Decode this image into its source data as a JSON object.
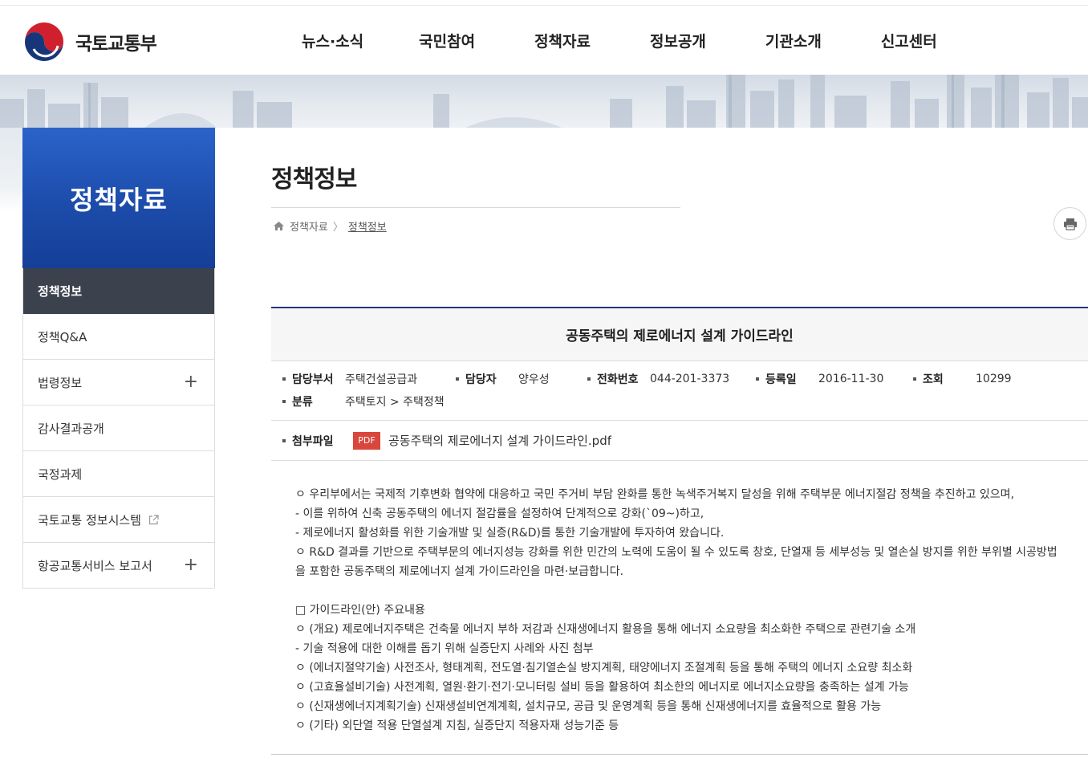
{
  "header": {
    "logo_text": "국토교통부",
    "nav": [
      "뉴스·소식",
      "국민참여",
      "정책자료",
      "정보공개",
      "기관소개",
      "신고센터"
    ]
  },
  "sidebar": {
    "title": "정책자료",
    "items": [
      {
        "label": "정책정보",
        "active": true,
        "expandable": false,
        "external": false
      },
      {
        "label": "정책Q&A",
        "active": false,
        "expandable": false,
        "external": false
      },
      {
        "label": "법령정보",
        "active": false,
        "expandable": true,
        "external": false
      },
      {
        "label": "감사결과공개",
        "active": false,
        "expandable": false,
        "external": false
      },
      {
        "label": "국정과제",
        "active": false,
        "expandable": false,
        "external": false
      },
      {
        "label": "국토교통 정보시스템",
        "active": false,
        "expandable": false,
        "external": true
      },
      {
        "label": "항공교통서비스 보고서",
        "active": false,
        "expandable": true,
        "external": false
      }
    ],
    "plus_symbol": "+"
  },
  "content": {
    "page_title": "정책정보",
    "breadcrumb": {
      "parent": "정책자료",
      "separator": "〉",
      "current": "정책정보"
    },
    "post": {
      "title": "공동주택의 제로에너지 설계 가이드라인",
      "meta": {
        "dept_label": "담당부서",
        "dept": "주택건설공급과",
        "manager_label": "담당자",
        "manager": "양우성",
        "phone_label": "전화번호",
        "phone": "044-201-3373",
        "date_label": "등록일",
        "date": "2016-11-30",
        "views_label": "조회",
        "views": "10299",
        "category_label": "분류",
        "category": "주택토지 > 주택정책"
      },
      "attachment": {
        "label": "첨부파일",
        "badge": "PDF",
        "filename": "공동주택의 제로에너지 설계 가이드라인.pdf"
      },
      "body": [
        "ㅇ 우리부에서는 국제적 기후변화 협약에 대응하고 국민 주거비 부담 완화를 통한 녹색주거복지 달성을 위해 주택부문 에너지절감 정책을 추진하고 있으며,",
        "- 이를 위하여 신축 공동주택의 에너지 절감률을 설정하여 단계적으로 강화(`09~)하고,",
        "- 제로에너지 활성화를 위한 기술개발 및 실증(R&D)를 통한 기술개발에 투자하여 왔습니다.",
        "ㅇ R&D 결과를 기반으로 주택부문의 에너지성능 강화를 위한 민간의 노력에 도움이 될 수 있도록 창호, 단열재 등 세부성능 및 열손실 방지를 위한 부위별 시공방법을 포함한 공동주택의 제로에너지 설계 가이드라인을 마련·보급합니다.",
        "",
        "□ 가이드라인(안) 주요내용",
        "ㅇ (개요) 제로에너지주택은 건축물 에너지 부하 저감과 신재생에너지 활용을 통해 에너지 소요량을 최소화한 주택으로 관련기술 소개",
        "- 기술 적용에 대한 이해를 돕기 위해 실증단지 사례와 사진 첨부",
        "ㅇ (에너지절약기술) 사전조사, 형태계획, 전도열·침기열손실 방지계획, 태양에너지 조절계획 등을 통해 주택의 에너지 소요량 최소화",
        "ㅇ (고효율설비기술) 사전계획, 열원·환기·전기·모니터링 설비 등을 활용하여 최소한의 에너지로 에너지소요량을 충족하는 설계 가능",
        "ㅇ (신재생에너지계획기술) 신재생설비연계계획, 설치규모, 공급 및 운영계획 등을 통해 신재생에너지를 효율적으로 활용 가능",
        "ㅇ (기타) 외단열 적용 단열설계 지침, 실증단지 적용자재 성능기준 등"
      ]
    }
  },
  "colors": {
    "sidebar_title_bg": "#1f52b5",
    "sidebar_active_bg": "#3c414e",
    "board_top_line": "#1d3d75",
    "pdf_badge": "#d9463c"
  },
  "icons": [
    "government-emblem-icon",
    "home-icon",
    "print-icon",
    "external-link-icon",
    "plus-icon"
  ]
}
